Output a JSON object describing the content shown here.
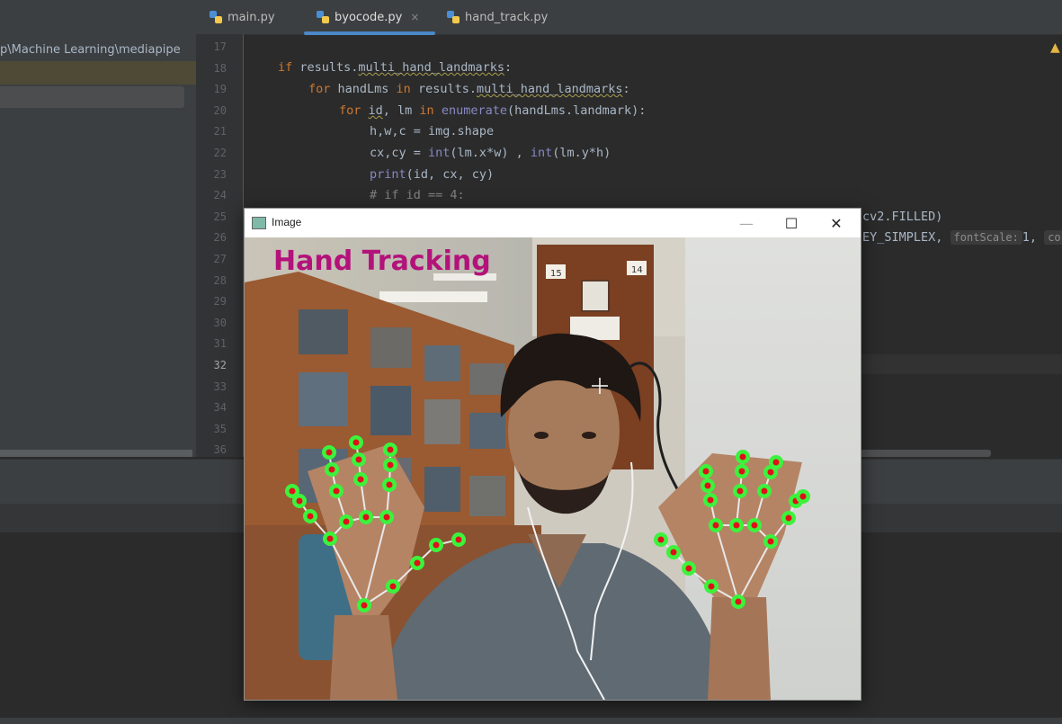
{
  "tabs": [
    {
      "label": "main.py",
      "active": false
    },
    {
      "label": "byocode.py",
      "active": true,
      "close": "×"
    },
    {
      "label": "hand_track.py",
      "active": false
    }
  ],
  "project": {
    "path": "p\\Machine Learning\\mediapipe"
  },
  "editor": {
    "line_numbers": [
      "17",
      "18",
      "19",
      "20",
      "21",
      "22",
      "23",
      "24",
      "25",
      "26",
      "27",
      "28",
      "29",
      "30",
      "31",
      "32",
      "33",
      "34",
      "35",
      "36"
    ],
    "current_line": "32",
    "code": {
      "l18": {
        "kw": "if ",
        "a": "results.",
        "u": "multi_hand_landmarks",
        "b": ":"
      },
      "l19": {
        "kw": "for ",
        "a": "handLms ",
        "kw2": "in ",
        "b": "results.",
        "u": "multi_hand_landmarks",
        "c": ":"
      },
      "l20": {
        "kw": "for ",
        "u": "id",
        "a": ", lm ",
        "kw2": "in ",
        "bi": "enumerate",
        "b": "(handLms.landmark):"
      },
      "l21": "h,w,c = img.shape",
      "l22": {
        "a": "cx,cy = ",
        "bi1": "int",
        "b": "(lm.x*w) , ",
        "bi2": "int",
        "c": "(lm.y*h)"
      },
      "l23": {
        "bi": "print",
        "a": "(id, cx, cy)"
      },
      "l24": "# if id == 4:",
      "l25_tail": "cv2.FILLED)",
      "l26_tail": "EY_SIMPLEX,",
      "hint1": "fontScale:",
      "hint1_val": "1,",
      "hint2": "co"
    }
  },
  "cv_window": {
    "title": "Image",
    "minimize_icon": "—",
    "maximize_icon": "☐",
    "close_icon": "✕",
    "overlay_text": "Hand Tracking",
    "shelf_numbers": [
      "15",
      "14"
    ]
  },
  "colors": {
    "overlay_text": "#b3127a",
    "landmark_ring": "#3cf23c",
    "landmark_dot": "#e0101a",
    "connection": "#e8e8e8"
  }
}
